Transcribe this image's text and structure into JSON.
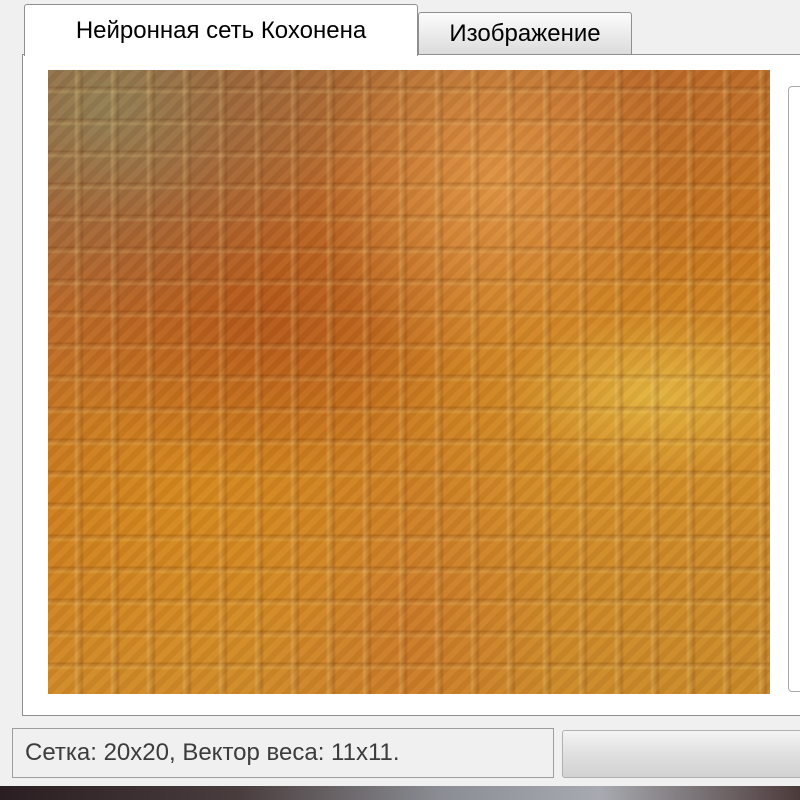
{
  "tabs": [
    {
      "label": "Нейронная сеть Кохонена",
      "active": true
    },
    {
      "label": "Изображение",
      "active": false
    }
  ],
  "status": {
    "text": "Сетка: 20x20, Вектор веса: 11x11."
  },
  "colors": {
    "window_bg": "#f0f0f0",
    "panel_bg": "#ffffff",
    "map_dominant": "#c9781f",
    "map_highlight": "#e6be46"
  }
}
